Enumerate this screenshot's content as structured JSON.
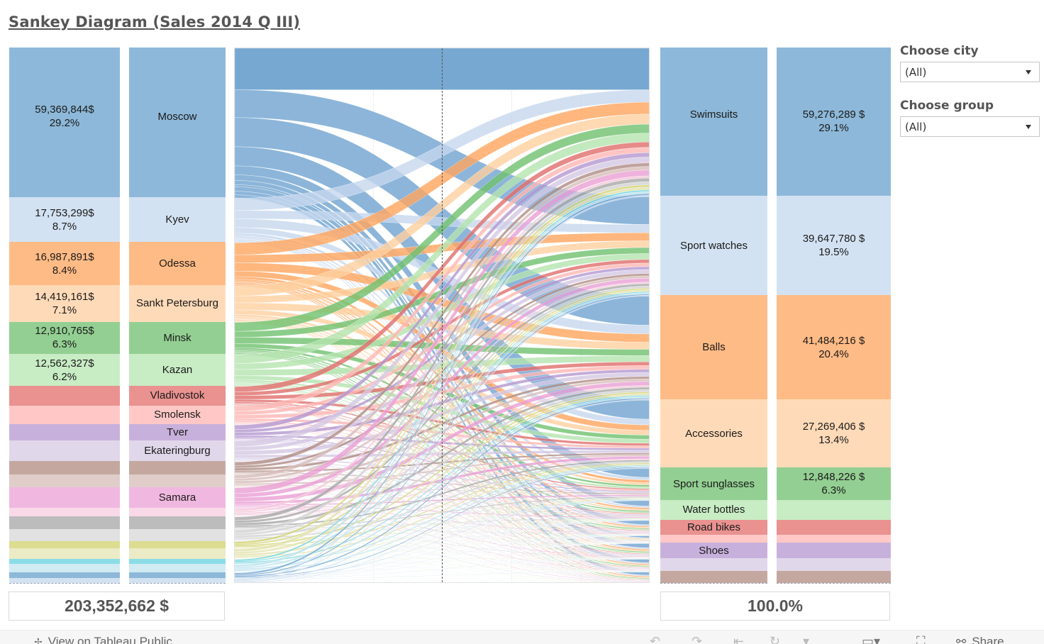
{
  "title": "Sankey Diagram (Sales 2014 Q III)",
  "filters": [
    {
      "label": "Choose city",
      "value": "(All)"
    },
    {
      "label": "Choose group",
      "value": "(All)"
    }
  ],
  "totals": {
    "left": "203,352,662 $",
    "right": "100.0%"
  },
  "footer": {
    "view_link": "View on Tableau Public",
    "toolbar_icons": [
      "undo-icon",
      "redo-icon",
      "revert-icon",
      "refresh-icon",
      "pause-dropdown-icon",
      "device-layout-icon",
      "fullscreen-icon"
    ],
    "share_label": "Share"
  },
  "chart_data": {
    "type": "sankey",
    "title": "Sankey Diagram (Sales 2014 Q III)",
    "total": 203352662,
    "currency": "$",
    "cities": [
      {
        "name": "Moscow",
        "value": 59369844,
        "value_label": "59,369,844$",
        "pct": "29.2%",
        "share": 29.2,
        "color": "#8db8d9"
      },
      {
        "name": "Kyev",
        "value": 17753299,
        "value_label": "17,753,299$",
        "pct": "8.7%",
        "share": 8.7,
        "color": "#d3e2f2"
      },
      {
        "name": "Odessa",
        "value": 16987891,
        "value_label": "16,987,891$",
        "pct": "8.4%",
        "share": 8.4,
        "color": "#ffbb85"
      },
      {
        "name": "Sankt Petersburg",
        "value": 14419161,
        "value_label": "14,419,161$",
        "pct": "7.1%",
        "share": 7.1,
        "color": "#ffdab8"
      },
      {
        "name": "Minsk",
        "value": 12910765,
        "value_label": "12,910,765$",
        "pct": "6.3%",
        "share": 6.3,
        "color": "#93cf92"
      },
      {
        "name": "Kazan",
        "value": 12562327,
        "value_label": "12,562,327$",
        "pct": "6.2%",
        "share": 6.2,
        "color": "#c8ecc4"
      },
      {
        "name": "Vladivostok",
        "value_label": "",
        "pct": "",
        "share": 3.8,
        "color": "#e99290"
      },
      {
        "name": "Smolensk",
        "value_label": "",
        "pct": "",
        "share": 3.7,
        "color": "#ffc8c6"
      },
      {
        "name": "Tver",
        "value_label": "",
        "pct": "",
        "share": 3.1,
        "color": "#c8b0dc"
      },
      {
        "name": "Ekateringburg",
        "value_label": "",
        "pct": "",
        "share": 4.1,
        "color": "#e1d7eb"
      },
      {
        "name": "",
        "value_label": "",
        "pct": "",
        "share": 2.5,
        "color": "#c4a8a0"
      },
      {
        "name": "",
        "value_label": "",
        "pct": "",
        "share": 2.5,
        "color": "#e0cdca"
      },
      {
        "name": "Samara",
        "value_label": "",
        "pct": "",
        "share": 4.1,
        "color": "#f0b8e0"
      },
      {
        "name": "",
        "value_label": "",
        "pct": "",
        "share": 1.6,
        "color": "#f9d9e7"
      },
      {
        "name": "",
        "value_label": "",
        "pct": "",
        "share": 2.5,
        "color": "#bcbcbc"
      },
      {
        "name": "",
        "value_label": "",
        "pct": "",
        "share": 2.3,
        "color": "#e1e1e1"
      },
      {
        "name": "",
        "value_label": "",
        "pct": "",
        "share": 1.4,
        "color": "#dcdd90"
      },
      {
        "name": "",
        "value_label": "",
        "pct": "",
        "share": 2.1,
        "color": "#ebebc6"
      },
      {
        "name": "",
        "value_label": "",
        "pct": "",
        "share": 1.0,
        "color": "#8adde6"
      },
      {
        "name": "",
        "value_label": "",
        "pct": "",
        "share": 1.6,
        "color": "#d0ebf2"
      },
      {
        "name": "",
        "value_label": "",
        "pct": "",
        "share": 1.2,
        "color": "#8db8d9"
      },
      {
        "name": "",
        "value_label": "",
        "pct": "",
        "share": 0.9,
        "color": "#d3e2f2"
      }
    ],
    "groups": [
      {
        "name": "Swimsuits",
        "value": 59276289,
        "value_label": "59,276,289 $",
        "pct": "29.1%",
        "share": 29.1,
        "color": "#8db8d9"
      },
      {
        "name": "Sport watches",
        "value": 39647780,
        "value_label": "39,647,780 $",
        "pct": "19.5%",
        "share": 19.5,
        "color": "#d3e2f2"
      },
      {
        "name": "Balls",
        "value": 41484216,
        "value_label": "41,484,216 $",
        "pct": "20.4%",
        "share": 20.4,
        "color": "#ffbb85"
      },
      {
        "name": "Accessories",
        "value": 27269406,
        "value_label": "27,269,406 $",
        "pct": "13.4%",
        "share": 13.4,
        "color": "#ffdab8"
      },
      {
        "name": "Sport sunglasses",
        "value": 12848226,
        "value_label": "12,848,226 $",
        "pct": "6.3%",
        "share": 6.3,
        "color": "#93cf92"
      },
      {
        "name": "Water bottles",
        "value_label": "",
        "pct": "",
        "share": 3.9,
        "color": "#c8ecc4"
      },
      {
        "name": "Road bikes",
        "value_label": "",
        "pct": "",
        "share": 3.0,
        "color": "#e99290"
      },
      {
        "name": "",
        "value_label": "",
        "pct": "",
        "share": 1.5,
        "color": "#ffc8c6"
      },
      {
        "name": "Shoes",
        "value_label": "",
        "pct": "",
        "share": 3.1,
        "color": "#c8b0dc"
      },
      {
        "name": "",
        "value_label": "",
        "pct": "",
        "share": 2.5,
        "color": "#e1d7eb"
      },
      {
        "name": "",
        "value_label": "",
        "pct": "",
        "share": 2.3,
        "color": "#c4a8a0"
      }
    ]
  }
}
